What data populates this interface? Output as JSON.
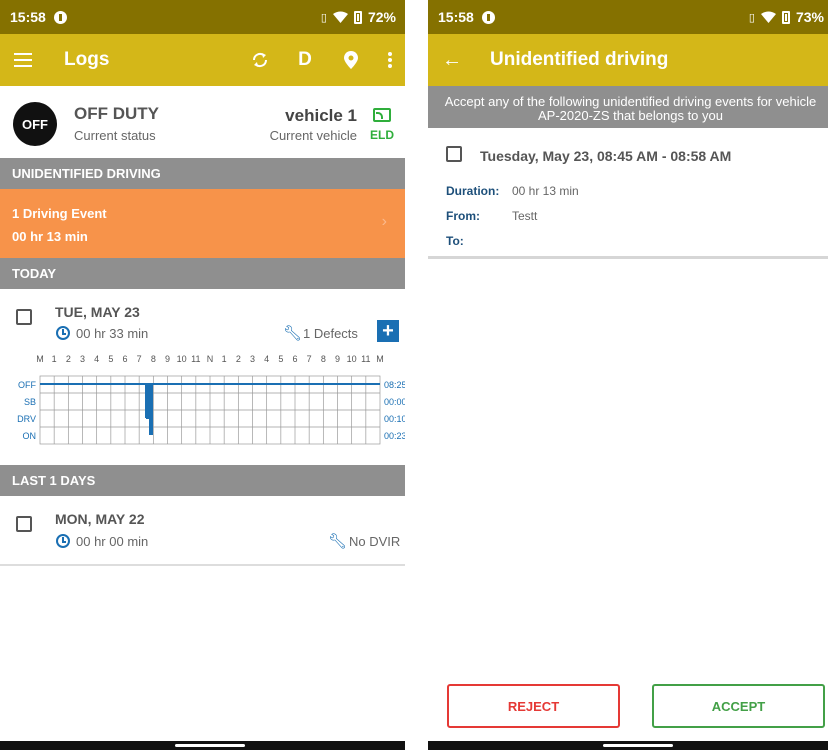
{
  "left": {
    "statusbar": {
      "time": "15:58",
      "battery": "72%"
    },
    "appbar": {
      "title": "Logs",
      "daily_button": "D"
    },
    "current_status": {
      "badge": "OFF",
      "title": "OFF DUTY",
      "subtitle": "Current status"
    },
    "vehicle": {
      "title": "vehicle 1",
      "subtitle": "Current vehicle",
      "eld_label": "ELD"
    },
    "unidentified": {
      "header": "UNIDENTIFIED DRIVING",
      "event_title": "1 Driving Event",
      "event_duration": "00 hr  13 min"
    },
    "today": {
      "header": "TODAY",
      "day": {
        "title": "TUE, MAY 23",
        "duration": "00 hr  33 min",
        "defects": "1 Defects"
      }
    },
    "graph": {
      "hours": [
        "M",
        "1",
        "2",
        "3",
        "4",
        "5",
        "6",
        "7",
        "8",
        "9",
        "10",
        "11",
        "N",
        "1",
        "2",
        "3",
        "4",
        "5",
        "6",
        "7",
        "8",
        "9",
        "10",
        "11",
        "M"
      ],
      "rows": [
        {
          "label": "OFF",
          "total": "08:25"
        },
        {
          "label": "SB",
          "total": "00:00"
        },
        {
          "label": "DRV",
          "total": "00:10"
        },
        {
          "label": "ON",
          "total": "00:23"
        }
      ]
    },
    "last_days": {
      "header": "LAST 1 DAYS",
      "day": {
        "title": "MON, MAY 22",
        "duration": "00 hr  00 min",
        "dvir": "No DVIR"
      }
    }
  },
  "right": {
    "statusbar": {
      "time": "15:58",
      "battery": "73%"
    },
    "appbar": {
      "title": "Unidentified driving"
    },
    "banner": "Accept any of the following unidentified driving events for vehicle AP-2020-ZS that belongs to you",
    "event": {
      "title": "Tuesday, May 23, 08:45 AM - 08:58 AM",
      "duration_label": "Duration:",
      "duration_value": "00 hr  13 min",
      "from_label": "From:",
      "from_value": "Testt",
      "to_label": "To:"
    },
    "buttons": {
      "reject": "REJECT",
      "accept": "ACCEPT"
    }
  },
  "colors": {
    "appbar": "#d4b718",
    "statusbar": "#857100",
    "event": "#f7934a",
    "accent_blue": "#1a6fb3",
    "eld_green": "#2fae3b"
  }
}
